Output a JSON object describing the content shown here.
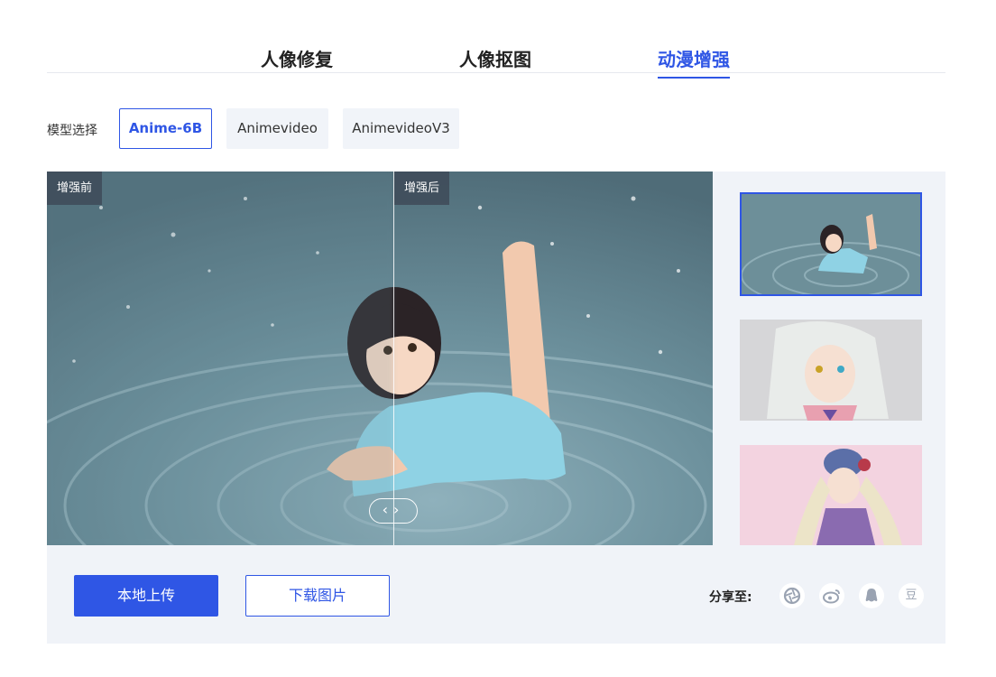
{
  "tabs": [
    "人像修复",
    "人像抠图",
    "动漫增强"
  ],
  "active_tab": "动漫增强",
  "model": {
    "label": "模型选择",
    "options": [
      "Anime-6B",
      "Animevideo",
      "AnimevideoV3"
    ],
    "selected": "Anime-6B"
  },
  "compare": {
    "before_label": "增强前",
    "after_label": "增强后",
    "handle_glyph": "‹›"
  },
  "actions": {
    "upload": "本地上传",
    "download": "下载图片"
  },
  "share": {
    "label": "分享至:",
    "icons": [
      "camera-aperture-icon",
      "weibo-icon",
      "qq-icon",
      "douban-icon"
    ],
    "douban_glyph": "豆"
  },
  "colors": {
    "accent": "#2f56e5",
    "panel_bg": "#f0f3f8"
  }
}
